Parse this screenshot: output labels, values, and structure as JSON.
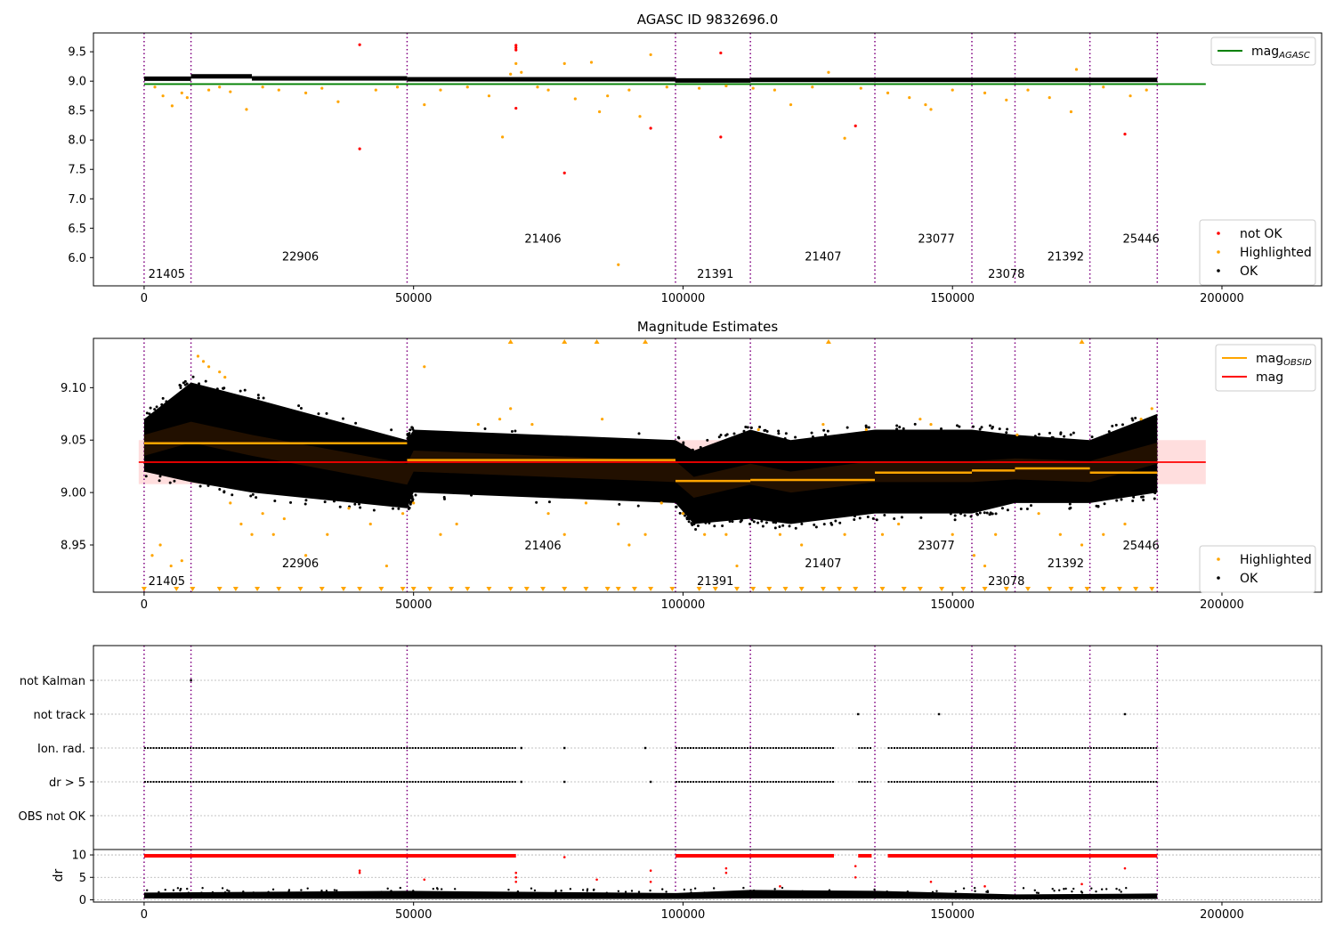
{
  "chart_data": [
    {
      "type": "scatter",
      "title": "AGASC ID 9832696.0",
      "xlim": [
        -9400,
        218500
      ],
      "ylim": [
        5.52,
        9.82
      ],
      "xticks": [
        0,
        50000,
        100000,
        150000,
        200000
      ],
      "xtick_labels": [
        "0",
        "50000",
        "100000",
        "150000",
        "200000"
      ],
      "yticks": [
        6.0,
        6.5,
        7.0,
        7.5,
        8.0,
        8.5,
        9.0,
        9.5
      ],
      "ytick_labels": [
        "6.0",
        "6.5",
        "7.0",
        "7.5",
        "8.0",
        "8.5",
        "9.0",
        "9.5"
      ],
      "legend_upper": {
        "position": "top-right",
        "entries": [
          {
            "label": "mag",
            "sub": "AGASC",
            "color": "#008000"
          }
        ]
      },
      "legend_lower": {
        "position": "bottom-right",
        "entries": [
          {
            "label": "not OK",
            "color": "#ff0000"
          },
          {
            "label": "Highlighted",
            "color": "#ffa500"
          },
          {
            "label": "OK",
            "color": "#000000"
          }
        ]
      },
      "mag_agasc": {
        "value": 8.95,
        "x_range": [
          0,
          197000
        ]
      },
      "obsid_boundaries": [
        0,
        8700,
        48800,
        98600,
        112500,
        135600,
        153600,
        161600,
        175500,
        188000
      ],
      "obsid_labels": [
        {
          "text": "21405",
          "x": 4200,
          "y": 5.73
        },
        {
          "text": "22906",
          "x": 29000,
          "y": 6.03
        },
        {
          "text": "21406",
          "x": 74000,
          "y": 6.33
        },
        {
          "text": "21391",
          "x": 106000,
          "y": 5.73
        },
        {
          "text": "21407",
          "x": 126000,
          "y": 6.03
        },
        {
          "text": "23077",
          "x": 147000,
          "y": 6.33
        },
        {
          "text": "23078",
          "x": 160000,
          "y": 5.73
        },
        {
          "text": "21392",
          "x": 171000,
          "y": 6.03
        },
        {
          "text": "25446",
          "x": 185000,
          "y": 6.33
        }
      ],
      "ok_band_segments": [
        [
          0,
          8700,
          9.05
        ],
        [
          8700,
          20000,
          9.09
        ],
        [
          20000,
          48800,
          9.055
        ],
        [
          48800,
          98600,
          9.04
        ],
        [
          98600,
          112500,
          9.02
        ],
        [
          112500,
          188000,
          9.03
        ]
      ],
      "highlighted_points": [
        [
          2000,
          8.9
        ],
        [
          3500,
          8.75
        ],
        [
          5200,
          8.58
        ],
        [
          7000,
          8.8
        ],
        [
          8000,
          8.72
        ],
        [
          12000,
          8.85
        ],
        [
          14000,
          8.9
        ],
        [
          16000,
          8.82
        ],
        [
          19000,
          8.52
        ],
        [
          22000,
          8.9
        ],
        [
          25000,
          8.85
        ],
        [
          30000,
          8.8
        ],
        [
          33000,
          8.88
        ],
        [
          36000,
          8.65
        ],
        [
          43000,
          8.85
        ],
        [
          47000,
          8.9
        ],
        [
          52000,
          8.6
        ],
        [
          55000,
          8.85
        ],
        [
          60000,
          8.9
        ],
        [
          64000,
          8.75
        ],
        [
          66500,
          8.05
        ],
        [
          68000,
          9.12
        ],
        [
          69000,
          9.3
        ],
        [
          70000,
          9.15
        ],
        [
          73000,
          8.9
        ],
        [
          75000,
          8.85
        ],
        [
          78000,
          9.3
        ],
        [
          80000,
          8.7
        ],
        [
          83000,
          9.32
        ],
        [
          84500,
          8.48
        ],
        [
          86000,
          8.75
        ],
        [
          88000,
          5.88
        ],
        [
          90000,
          8.85
        ],
        [
          92000,
          8.4
        ],
        [
          94000,
          9.45
        ],
        [
          97000,
          8.9
        ],
        [
          103000,
          8.88
        ],
        [
          108000,
          8.92
        ],
        [
          113000,
          8.88
        ],
        [
          117000,
          8.85
        ],
        [
          120000,
          8.6
        ],
        [
          124000,
          8.9
        ],
        [
          127000,
          9.15
        ],
        [
          130000,
          8.03
        ],
        [
          133000,
          8.88
        ],
        [
          138000,
          8.8
        ],
        [
          142000,
          8.72
        ],
        [
          145000,
          8.6
        ],
        [
          146000,
          8.52
        ],
        [
          150000,
          8.85
        ],
        [
          156000,
          8.8
        ],
        [
          160000,
          8.68
        ],
        [
          164000,
          8.85
        ],
        [
          168000,
          8.72
        ],
        [
          172000,
          8.48
        ],
        [
          173000,
          9.2
        ],
        [
          178000,
          8.9
        ],
        [
          183000,
          8.75
        ],
        [
          186000,
          8.85
        ]
      ],
      "not_ok_points": [
        [
          40000,
          9.62
        ],
        [
          40000,
          7.85
        ],
        [
          69000,
          9.61
        ],
        [
          69000,
          9.57
        ],
        [
          69000,
          9.53
        ],
        [
          69000,
          8.54
        ],
        [
          78000,
          7.44
        ],
        [
          94000,
          8.2
        ],
        [
          107000,
          9.48
        ],
        [
          107000,
          8.05
        ],
        [
          132000,
          8.24
        ],
        [
          182000,
          8.1
        ]
      ]
    },
    {
      "type": "scatter",
      "title": "Magnitude Estimates",
      "xlim": [
        -9400,
        218500
      ],
      "ylim": [
        8.905,
        9.147
      ],
      "xticks": [
        0,
        50000,
        100000,
        150000,
        200000
      ],
      "xtick_labels": [
        "0",
        "50000",
        "100000",
        "150000",
        "200000"
      ],
      "yticks": [
        8.95,
        9.0,
        9.05,
        9.1
      ],
      "ytick_labels": [
        "8.95",
        "9.00",
        "9.05",
        "9.10"
      ],
      "legend_upper": {
        "position": "top-right",
        "entries": [
          {
            "label": "mag",
            "sub": "OBSID",
            "color": "#ffa500"
          },
          {
            "label": "mag",
            "sub": "",
            "color": "#ff0000"
          }
        ]
      },
      "legend_lower": {
        "position": "bottom-right",
        "entries": [
          {
            "label": "Highlighted",
            "color": "#ffa500"
          },
          {
            "label": "OK",
            "color": "#000000"
          }
        ]
      },
      "mag": {
        "value": 9.029,
        "band": [
          9.008,
          9.05
        ],
        "x_range": [
          -1000,
          197000
        ]
      },
      "mag_obsid": [
        [
          0,
          48800,
          9.047
        ],
        [
          48800,
          98600,
          9.031
        ],
        [
          98600,
          112500,
          9.011
        ],
        [
          112500,
          135600,
          9.012
        ],
        [
          135600,
          153600,
          9.019
        ],
        [
          153600,
          161600,
          9.021
        ],
        [
          161600,
          175500,
          9.023
        ],
        [
          175500,
          188000,
          9.019
        ]
      ],
      "ok_envelope": [
        [
          0,
          9.02,
          9.07
        ],
        [
          8700,
          9.01,
          9.105
        ],
        [
          20000,
          9.0,
          9.09
        ],
        [
          48800,
          8.985,
          9.05
        ],
        [
          50000,
          9.0,
          9.06
        ],
        [
          98600,
          8.99,
          9.05
        ],
        [
          102000,
          8.97,
          9.04
        ],
        [
          112500,
          8.975,
          9.06
        ],
        [
          120000,
          8.97,
          9.05
        ],
        [
          135600,
          8.98,
          9.06
        ],
        [
          153600,
          8.98,
          9.06
        ],
        [
          161600,
          8.99,
          9.055
        ],
        [
          175500,
          8.99,
          9.05
        ],
        [
          188000,
          9.0,
          9.075
        ]
      ],
      "obsid_boundaries": [
        0,
        8700,
        48800,
        98600,
        112500,
        135600,
        153600,
        161600,
        175500,
        188000
      ],
      "obsid_labels": [
        {
          "text": "21405",
          "x": 4200,
          "y": 8.916
        },
        {
          "text": "22906",
          "x": 29000,
          "y": 8.933
        },
        {
          "text": "21406",
          "x": 74000,
          "y": 8.95
        },
        {
          "text": "21391",
          "x": 106000,
          "y": 8.916
        },
        {
          "text": "21407",
          "x": 126000,
          "y": 8.933
        },
        {
          "text": "23077",
          "x": 147000,
          "y": 8.95
        },
        {
          "text": "23078",
          "x": 160000,
          "y": 8.916
        },
        {
          "text": "21392",
          "x": 171000,
          "y": 8.933
        },
        {
          "text": "25446",
          "x": 185000,
          "y": 8.95
        }
      ],
      "highlighted_points": [
        [
          1500,
          8.94
        ],
        [
          3000,
          8.95
        ],
        [
          5000,
          8.93
        ],
        [
          7000,
          8.935
        ],
        [
          10000,
          9.13
        ],
        [
          11000,
          9.125
        ],
        [
          12000,
          9.12
        ],
        [
          14000,
          9.115
        ],
        [
          15000,
          9.11
        ],
        [
          16000,
          8.99
        ],
        [
          18000,
          8.97
        ],
        [
          20000,
          8.96
        ],
        [
          22000,
          8.98
        ],
        [
          24000,
          8.96
        ],
        [
          26000,
          8.975
        ],
        [
          30000,
          8.94
        ],
        [
          34000,
          8.96
        ],
        [
          38000,
          8.985
        ],
        [
          42000,
          8.97
        ],
        [
          45000,
          8.93
        ],
        [
          48000,
          8.98
        ],
        [
          50000,
          8.99
        ],
        [
          52000,
          9.12
        ],
        [
          55000,
          8.96
        ],
        [
          58000,
          8.97
        ],
        [
          62000,
          9.065
        ],
        [
          66000,
          9.07
        ],
        [
          68000,
          9.08
        ],
        [
          72000,
          9.065
        ],
        [
          75000,
          8.98
        ],
        [
          78000,
          8.96
        ],
        [
          82000,
          8.99
        ],
        [
          85000,
          9.07
        ],
        [
          88000,
          8.97
        ],
        [
          90000,
          8.95
        ],
        [
          93000,
          8.96
        ],
        [
          96000,
          8.99
        ],
        [
          100000,
          8.98
        ],
        [
          104000,
          8.96
        ],
        [
          108000,
          8.96
        ],
        [
          110000,
          8.93
        ],
        [
          114000,
          9.06
        ],
        [
          118000,
          8.96
        ],
        [
          122000,
          8.95
        ],
        [
          126000,
          9.065
        ],
        [
          130000,
          8.96
        ],
        [
          134000,
          9.06
        ],
        [
          137000,
          8.96
        ],
        [
          140000,
          8.97
        ],
        [
          144000,
          9.07
        ],
        [
          146000,
          9.065
        ],
        [
          150000,
          8.96
        ],
        [
          154000,
          8.94
        ],
        [
          156000,
          8.93
        ],
        [
          158000,
          8.96
        ],
        [
          162000,
          9.055
        ],
        [
          166000,
          8.98
        ],
        [
          170000,
          8.96
        ],
        [
          174000,
          8.95
        ],
        [
          178000,
          8.96
        ],
        [
          182000,
          8.97
        ],
        [
          185000,
          9.07
        ],
        [
          187000,
          9.08
        ]
      ],
      "clipped_high": [
        68000,
        78000,
        84000,
        93000,
        127000,
        174000
      ],
      "clipped_low": [
        0,
        6000,
        9000,
        14000,
        17000,
        21000,
        25000,
        29000,
        33000,
        37000,
        40000,
        44000,
        48000,
        50000,
        53000,
        57000,
        60000,
        64000,
        68000,
        71000,
        74000,
        78000,
        82000,
        86000,
        88000,
        91000,
        94000,
        98000,
        103000,
        106000,
        110000,
        113000,
        116000,
        119000,
        122000,
        126000,
        129000,
        132000,
        137000,
        141000,
        144000,
        148000,
        152000,
        156000,
        160000,
        164000,
        168000,
        172000,
        175000,
        178000,
        181000,
        184000,
        187000
      ]
    },
    {
      "type": "scatter",
      "title": "",
      "xlim": [
        -9400,
        218500
      ],
      "categories": [
        "not Kalman",
        "not track",
        "Ion. rad.",
        "dr > 5",
        "OBS not OK"
      ],
      "flag_rows": [
        {
          "label": "not Kalman",
          "segments": [],
          "points": [
            8700
          ]
        },
        {
          "label": "not track",
          "segments": [],
          "points": [
            132500,
            147500,
            182000
          ]
        },
        {
          "label": "Ion. rad.",
          "segments": [
            [
              0,
              69000
            ],
            [
              98600,
              128000
            ],
            [
              130000,
              129000
            ],
            [
              132500,
              135000
            ],
            [
              138000,
              188000
            ]
          ],
          "points": [
            70000,
            78000,
            93000
          ]
        },
        {
          "label": "dr > 5",
          "segments": [
            [
              0,
              69000
            ],
            [
              98600,
              128000
            ],
            [
              132500,
              135000
            ],
            [
              138000,
              188000
            ]
          ],
          "points": [
            70000,
            78000,
            94000
          ]
        },
        {
          "label": "OBS not OK",
          "segments": [],
          "points": []
        }
      ],
      "obsid_boundaries": [
        0,
        8700,
        48800,
        98600,
        112500,
        135600,
        153600,
        161600,
        175500,
        188000
      ]
    },
    {
      "type": "scatter",
      "title": "",
      "ylabel": "dr",
      "xlim": [
        -9400,
        218500
      ],
      "ylim": [
        -0.5,
        11.2
      ],
      "xticks": [
        0,
        50000,
        100000,
        150000,
        200000
      ],
      "xtick_labels": [
        "0",
        "50000",
        "100000",
        "150000",
        "200000"
      ],
      "yticks": [
        0,
        5,
        10
      ],
      "ytick_labels": [
        "0",
        "5",
        "10"
      ],
      "red_segments": [
        [
          0,
          69000
        ],
        [
          98600,
          128000
        ],
        [
          132500,
          135000
        ],
        [
          138000,
          188000
        ]
      ],
      "red_points": [
        [
          40000,
          6.5
        ],
        [
          40000,
          6.0
        ],
        [
          52000,
          4.5
        ],
        [
          69000,
          6.0
        ],
        [
          69000,
          5.0
        ],
        [
          69000,
          4.0
        ],
        [
          78000,
          9.5
        ],
        [
          84000,
          4.5
        ],
        [
          94000,
          6.5
        ],
        [
          94000,
          4.0
        ],
        [
          108000,
          7.0
        ],
        [
          108000,
          6.0
        ],
        [
          118000,
          3.0
        ],
        [
          132000,
          7.5
        ],
        [
          132000,
          5.0
        ],
        [
          146000,
          4.0
        ],
        [
          156000,
          3.0
        ],
        [
          174000,
          3.5
        ],
        [
          182000,
          7.0
        ]
      ],
      "black_envelope": [
        [
          0,
          0.3,
          1.6
        ],
        [
          48800,
          0.2,
          2.0
        ],
        [
          98600,
          0.2,
          1.5
        ],
        [
          112500,
          0.3,
          2.2
        ],
        [
          135600,
          0.3,
          2.0
        ],
        [
          161600,
          0.1,
          1.2
        ],
        [
          188000,
          0.2,
          1.4
        ]
      ],
      "obsid_boundaries": [
        0,
        8700,
        48800,
        98600,
        112500,
        135600,
        153600,
        161600,
        175500,
        188000
      ]
    }
  ]
}
